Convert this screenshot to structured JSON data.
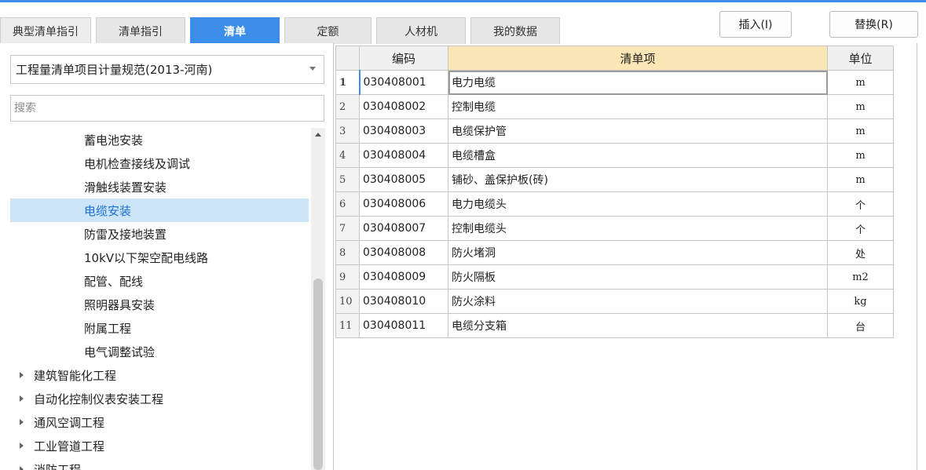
{
  "tabs": [
    "典型清单指引",
    "清单指引",
    "清单",
    "定额",
    "人材机",
    "我的数据"
  ],
  "buttons": {
    "insert": "插入(I)",
    "replace": "替换(R)"
  },
  "left": {
    "spec_select": "工程量清单项目计量规范(2013-河南)",
    "search_placeholder": "搜索",
    "tree": [
      "蓄电池安装",
      "电机检查接线及调试",
      "滑触线装置安装",
      "电缆安装",
      "防雷及接地装置",
      "10kV以下架空配电线路",
      "配管、配线",
      "照明器具安装",
      "附属工程",
      "电气调整试验",
      "建筑智能化工程",
      "自动化控制仪表安装工程",
      "通风空调工程",
      "工业管道工程",
      "消防工程"
    ],
    "selected_index": 3
  },
  "table": {
    "headers": {
      "code": "编码",
      "item": "清单项",
      "unit": "单位"
    },
    "rows": [
      {
        "n": "1",
        "code": "030408001",
        "item": "电力电缆",
        "unit": "m"
      },
      {
        "n": "2",
        "code": "030408002",
        "item": "控制电缆",
        "unit": "m"
      },
      {
        "n": "3",
        "code": "030408003",
        "item": "电缆保护管",
        "unit": "m"
      },
      {
        "n": "4",
        "code": "030408004",
        "item": "电缆槽盒",
        "unit": "m"
      },
      {
        "n": "5",
        "code": "030408005",
        "item": "铺砂、盖保护板(砖)",
        "unit": "m"
      },
      {
        "n": "6",
        "code": "030408006",
        "item": "电力电缆头",
        "unit": "个"
      },
      {
        "n": "7",
        "code": "030408007",
        "item": "控制电缆头",
        "unit": "个"
      },
      {
        "n": "8",
        "code": "030408008",
        "item": "防火堵洞",
        "unit": "处"
      },
      {
        "n": "9",
        "code": "030408009",
        "item": "防火隔板",
        "unit": "m2"
      },
      {
        "n": "10",
        "code": "030408010",
        "item": "防火涂料",
        "unit": "kg"
      },
      {
        "n": "11",
        "code": "030408011",
        "item": "电缆分支箱",
        "unit": "台"
      }
    ]
  },
  "colors": {
    "accent": "#3c8ee8",
    "selected_bg": "#cde5f9",
    "header_highlight": "#fbe6b6"
  }
}
